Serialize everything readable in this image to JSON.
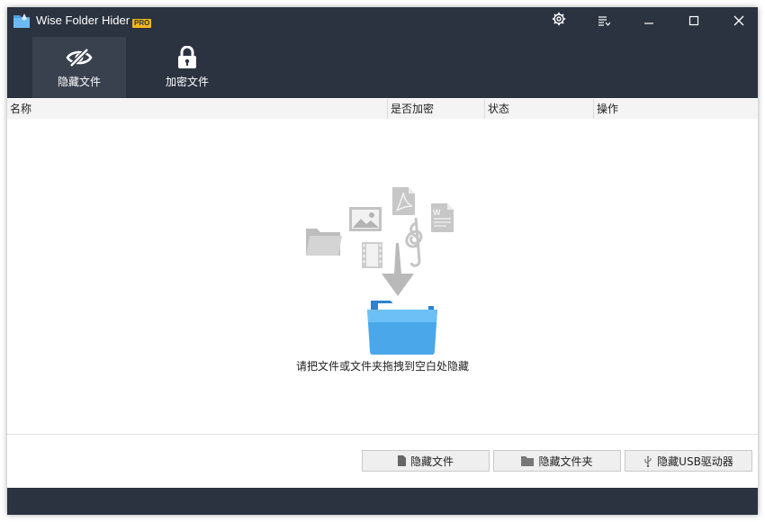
{
  "app": {
    "title": "Wise Folder Hider",
    "badge": "PRO"
  },
  "titlebar": {
    "buttons": [
      "settings-icon",
      "menu-icon",
      "minimize-icon",
      "maximize-icon",
      "close-icon"
    ]
  },
  "tabs": [
    {
      "label": "隐藏文件",
      "icon": "eye-slash-icon",
      "active": true
    },
    {
      "label": "加密文件",
      "icon": "lock-icon",
      "active": false
    }
  ],
  "table": {
    "columns": [
      "名称",
      "是否加密",
      "状态",
      "操作"
    ]
  },
  "empty_state": {
    "hint": "请把文件或文件夹拖拽到空白处隐藏",
    "icons": [
      "folder-icon",
      "image-icon",
      "pdf-icon",
      "document-icon",
      "music-icon",
      "film-icon",
      "arrow-down-icon",
      "blue-folder-icon"
    ]
  },
  "footer": {
    "hide_file_button": "隐藏文件",
    "hide_folder_button": "隐藏文件夹",
    "hide_usb_button": "隐藏USB驱动器"
  },
  "colors": {
    "titlebar_bg": "#2b3340",
    "active_tab_bg": "#39414e",
    "badge": "#f2b81b",
    "folder_blue": "#3a9be0"
  }
}
